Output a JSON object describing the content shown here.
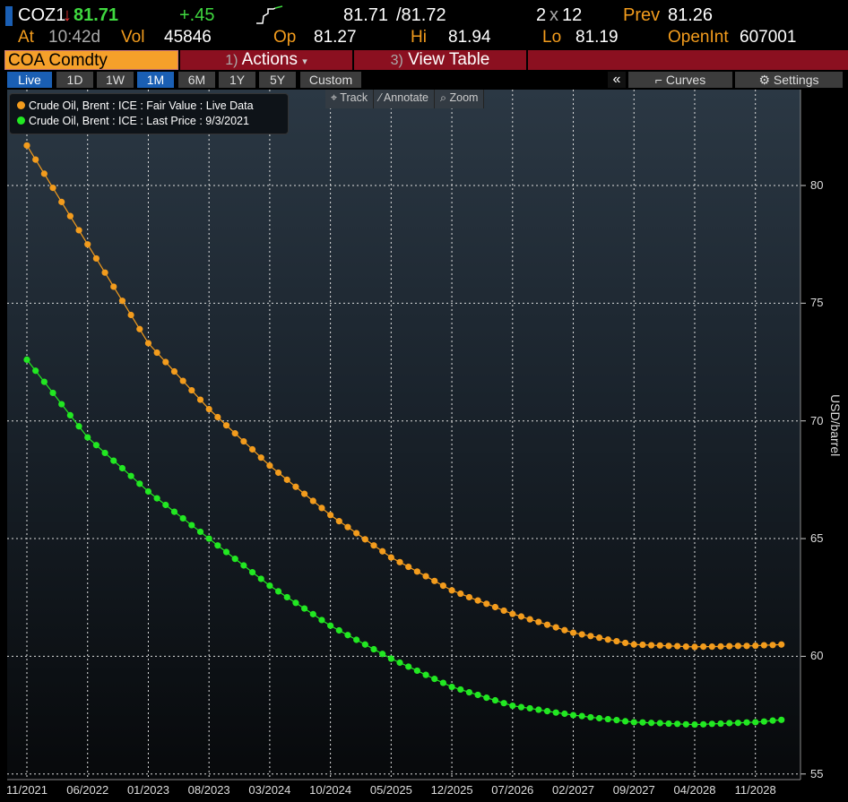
{
  "header": {
    "ticker": "COZ1",
    "arrow": "↓",
    "last": "81.71",
    "change": "+.45",
    "bid": "81.71",
    "ask": "/81.72",
    "size_a": "2",
    "size_x": "x",
    "size_b": "12",
    "prev_label": "Prev",
    "prev": "81.26",
    "at_label": "At",
    "time": "10:42d",
    "vol_label": "Vol",
    "vol": "45846",
    "op_label": "Op",
    "op": "81.27",
    "hi_label": "Hi",
    "hi": "81.94",
    "lo_label": "Lo",
    "lo": "81.19",
    "oi_label": "OpenInt",
    "oi": "607001"
  },
  "bar": {
    "security": "COA Comdty",
    "actions_num": "1)",
    "actions": "Actions",
    "actions_caret": "▾",
    "view_num": "3)",
    "view": "View Table"
  },
  "ranges": [
    "Live",
    "1D",
    "1W",
    "1M",
    "6M",
    "1Y",
    "5Y",
    "Custom"
  ],
  "right_tools": {
    "collapse": "«",
    "curves": "Curves",
    "settings": "Settings"
  },
  "chart_tools": {
    "track": "Track",
    "annotate": "Annotate",
    "zoom": "Zoom"
  },
  "colors": {
    "orange": "#f39c1d",
    "green": "#22e822",
    "accent_blue": "#1a5fb4",
    "maroon": "#8b1020"
  },
  "chart_data": {
    "type": "line",
    "title": "",
    "ylabel": "USD/barrel",
    "xlabel": "",
    "ylim": [
      54.5,
      87
    ],
    "yticks": [
      "55",
      "60",
      "65",
      "70",
      "75",
      "80"
    ],
    "xticks": [
      "11/2021",
      "06/2022",
      "01/2023",
      "08/2023",
      "03/2024",
      "10/2024",
      "05/2025",
      "12/2025",
      "07/2026",
      "02/2027",
      "09/2027",
      "04/2028",
      "11/2028"
    ],
    "x_start": "11/2021",
    "x_frequency": "monthly",
    "legend_position": "top-left",
    "grid": true,
    "series": [
      {
        "name": "Crude Oil, Brent : ICE : Fair Value : Live Data",
        "color": "#f39c1d",
        "values": [
          81.7,
          81.1,
          80.5,
          79.9,
          79.3,
          78.7,
          78.1,
          77.5,
          76.9,
          76.3,
          75.7,
          75.1,
          74.5,
          73.9,
          73.3,
          72.9,
          72.5,
          72.1,
          71.7,
          71.3,
          70.9,
          70.5,
          70.16,
          69.81,
          69.47,
          69.13,
          68.79,
          68.44,
          68.1,
          67.8,
          67.5,
          67.2,
          66.9,
          66.6,
          66.3,
          66.0,
          65.74,
          65.49,
          65.23,
          64.97,
          64.71,
          64.46,
          64.2,
          64.0,
          63.8,
          63.6,
          63.4,
          63.2,
          63.0,
          62.8,
          62.66,
          62.51,
          62.37,
          62.23,
          62.09,
          61.94,
          61.8,
          61.69,
          61.57,
          61.46,
          61.34,
          61.23,
          61.11,
          61.0,
          60.93,
          60.86,
          60.79,
          60.71,
          60.64,
          60.57,
          60.5,
          60.49,
          60.47,
          60.46,
          60.44,
          60.43,
          60.41,
          60.4,
          60.41,
          60.41,
          60.42,
          60.43,
          60.44,
          60.44,
          60.45,
          60.47,
          60.48,
          60.5
        ]
      },
      {
        "name": "Crude Oil, Brent : ICE : Last Price : 9/3/2021",
        "color": "#22e822",
        "values": [
          72.6,
          72.13,
          71.66,
          71.19,
          70.71,
          70.24,
          69.77,
          69.3,
          68.97,
          68.64,
          68.31,
          67.99,
          67.66,
          67.33,
          67.0,
          66.71,
          66.43,
          66.14,
          65.86,
          65.57,
          65.29,
          65.0,
          64.71,
          64.43,
          64.14,
          63.86,
          63.57,
          63.29,
          63.0,
          62.76,
          62.51,
          62.27,
          62.03,
          61.79,
          61.54,
          61.3,
          61.1,
          60.9,
          60.7,
          60.5,
          60.3,
          60.1,
          59.9,
          59.73,
          59.56,
          59.39,
          59.21,
          59.04,
          58.87,
          58.7,
          58.59,
          58.47,
          58.36,
          58.24,
          58.13,
          58.01,
          57.9,
          57.84,
          57.79,
          57.73,
          57.67,
          57.61,
          57.56,
          57.5,
          57.46,
          57.41,
          57.37,
          57.33,
          57.29,
          57.24,
          57.2,
          57.19,
          57.17,
          57.16,
          57.14,
          57.13,
          57.11,
          57.1,
          57.11,
          57.13,
          57.14,
          57.16,
          57.17,
          57.19,
          57.2,
          57.23,
          57.27,
          57.3
        ]
      }
    ]
  }
}
